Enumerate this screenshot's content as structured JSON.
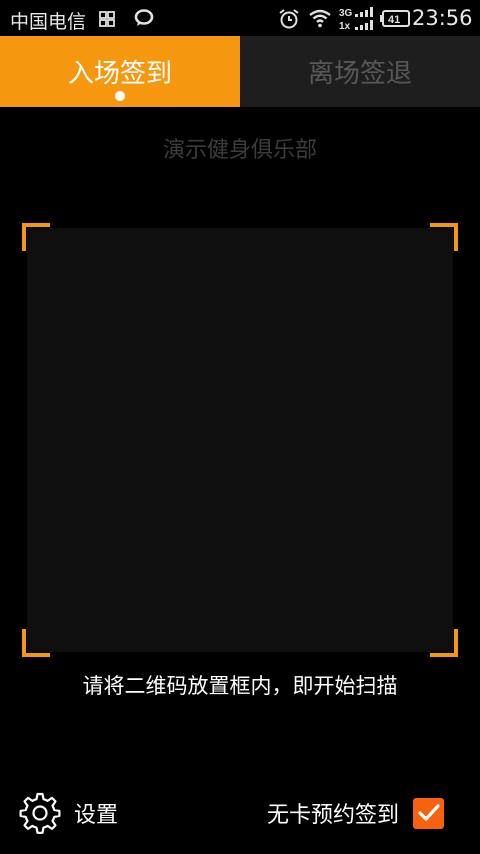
{
  "status_bar": {
    "carrier": "中国电信",
    "time": "23:56",
    "battery": "41",
    "network_top": "3G",
    "network_bottom": "1x",
    "icons": [
      "grid-icon",
      "chat-bubble-icon",
      "alarm-icon",
      "wifi-icon",
      "signal-icon",
      "battery-icon"
    ]
  },
  "tabs": [
    {
      "label": "入场签到",
      "active": true
    },
    {
      "label": "离场签退",
      "active": false
    }
  ],
  "club_name": "演示健身俱乐部",
  "scan_hint": "请将二维码放置框内，即开始扫描",
  "settings": {
    "label": "设置",
    "icon": "gear-icon"
  },
  "no_card_checkin": {
    "label": "无卡预约签到",
    "checked": true
  },
  "colors": {
    "accent": "#f6980f",
    "checkbox": "#f6630f",
    "tab_inactive_bg": "#1e1e1e",
    "background": "#000000"
  }
}
